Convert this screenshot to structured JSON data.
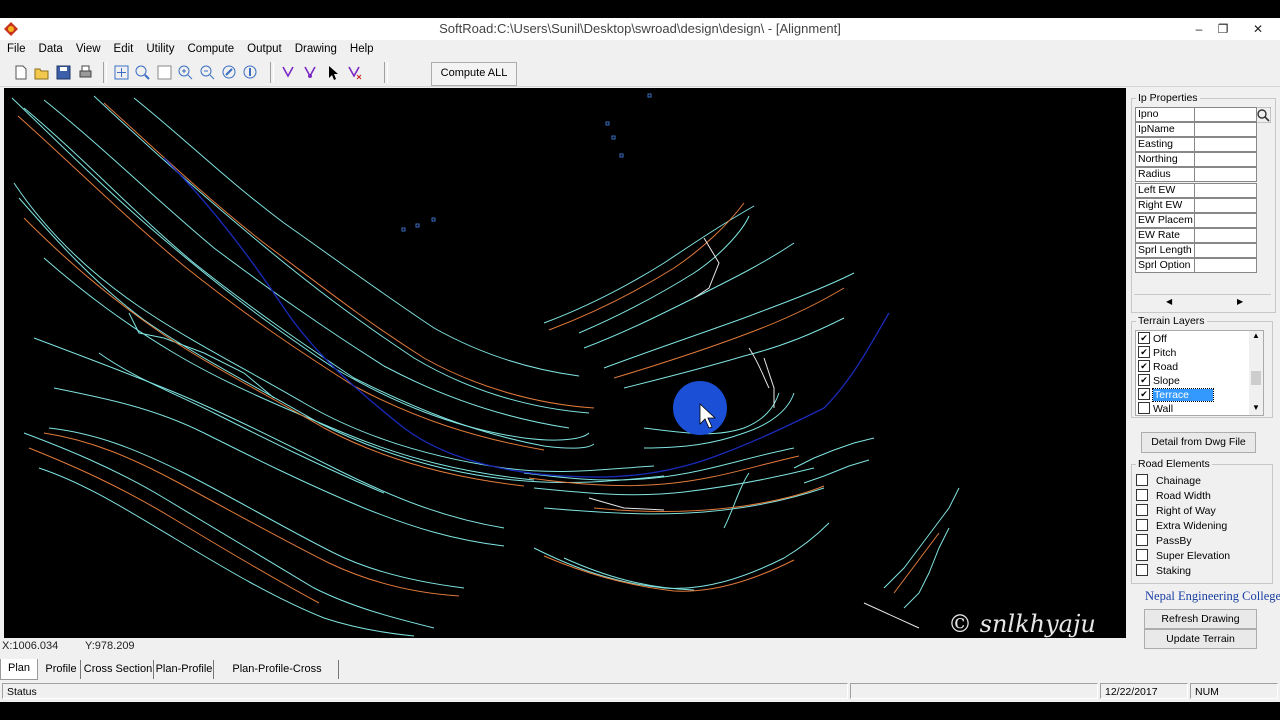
{
  "window": {
    "title": "SoftRoad:C:\\Users\\Sunil\\Desktop\\swroad\\design\\design\\ - [Alignment]",
    "minimize": "–",
    "restore": "❐",
    "close": "✕"
  },
  "menu": [
    "File",
    "Data",
    "View",
    "Edit",
    "Utility",
    "Compute",
    "Output",
    "Drawing",
    "Help"
  ],
  "toolbar": {
    "compute_all": "Compute ALL",
    "icons": [
      "new-file-icon",
      "open-folder-icon",
      "save-icon",
      "print-icon",
      "zoom-window-icon",
      "zoom-extents-icon",
      "pan-icon",
      "zoom-in-icon",
      "zoom-out-icon",
      "zoom-previous-icon",
      "zoom-realtime-icon",
      "ip-add-icon",
      "ip-edit-icon",
      "select-arrow-icon",
      "ip-delete-icon"
    ]
  },
  "ip_properties": {
    "title": "Ip Properties",
    "rows": [
      "Ipno",
      "IpName",
      "Easting",
      "Northing",
      "Radius",
      "Left EW",
      "Right EW",
      "EW Placem",
      "EW Rate",
      "Sprl Length",
      "Sprl Option"
    ],
    "prev": "◀",
    "next": "▶"
  },
  "terrain_layers": {
    "title": "Terrain Layers",
    "items": [
      {
        "label": "Off",
        "checked": true,
        "selected": false
      },
      {
        "label": "Pitch",
        "checked": true,
        "selected": false
      },
      {
        "label": "Road",
        "checked": true,
        "selected": false
      },
      {
        "label": "Slope",
        "checked": true,
        "selected": false
      },
      {
        "label": "Terrace",
        "checked": true,
        "selected": true
      },
      {
        "label": "Wall",
        "checked": false,
        "selected": false
      }
    ],
    "detail_button": "Detail from Dwg File"
  },
  "road_elements": {
    "title": "Road Elements",
    "items": [
      "Chainage",
      "Road Width",
      "Right of Way",
      "Extra Widening",
      "PassBy",
      "Super Elevation",
      "Staking"
    ]
  },
  "college": "Nepal Engineering College",
  "buttons": {
    "refresh": "Refresh Drawing",
    "update_terrain": "Update Terrain"
  },
  "coords": {
    "x": "X:1006.034",
    "y": "Y:978.209"
  },
  "tabs": [
    "Plan",
    "Profile",
    "Cross Section",
    "Plan-Profile",
    "Plan-Profile-Cross Section"
  ],
  "status": {
    "label": "Status",
    "date": "12/22/2017",
    "num": "NUM"
  },
  "watermark": "© snlkhyaju",
  "colors": {
    "canvas": "#000000",
    "contour_cyan": "#7fe3e0",
    "contour_orange": "#e07a3a",
    "alignment_blue": "#1a2ab8",
    "cursor_highlight": "#1a4fd6",
    "selected_bg": "#3399ff"
  }
}
